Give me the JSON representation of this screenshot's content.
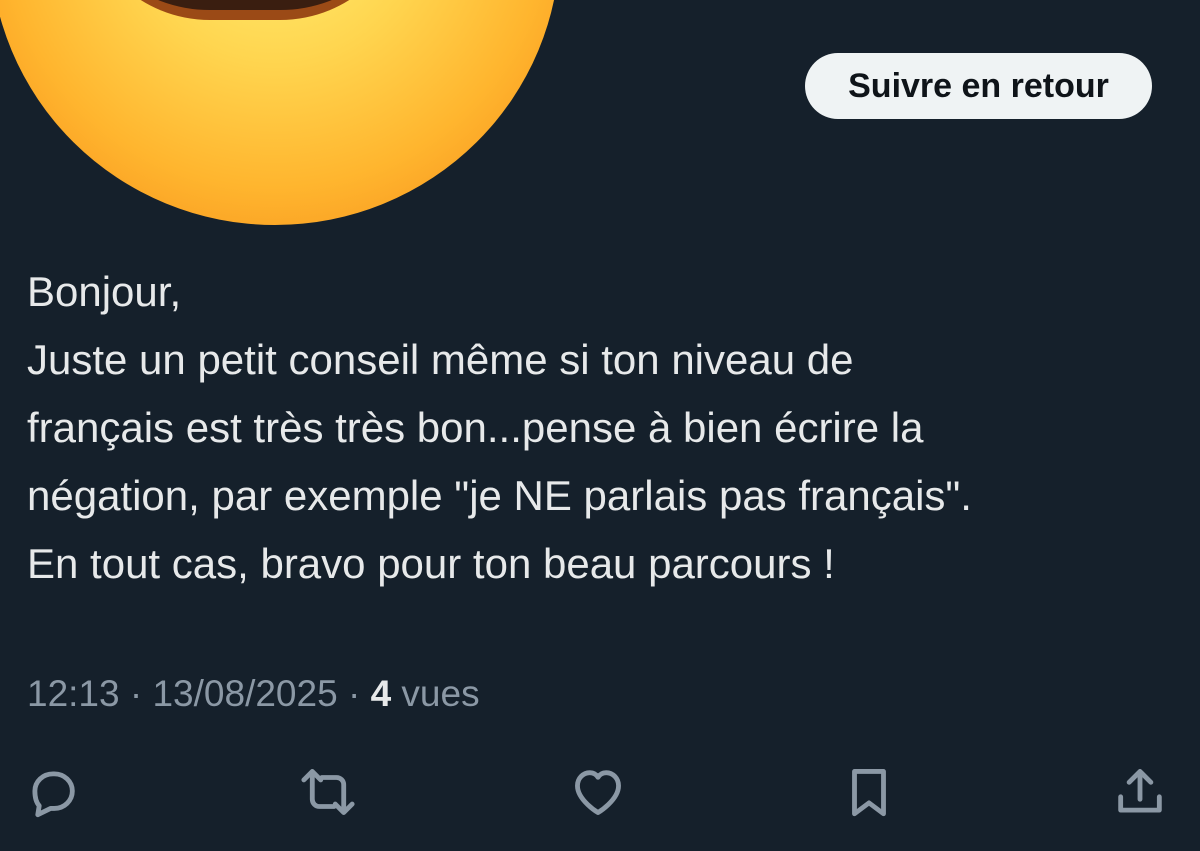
{
  "header": {
    "follow_button_label": "Suivre en retour"
  },
  "tweet": {
    "lines": [
      "Bonjour,",
      "Juste un petit conseil même si ton niveau de",
      "français est très très bon...pense à bien écrire la",
      "négation, par exemple \"je NE parlais pas français\".",
      "En tout cas, bravo pour ton beau parcours !"
    ],
    "time": "12:13",
    "separator": "·",
    "date": "13/08/2025",
    "views_count": "4",
    "views_label": "vues"
  },
  "actions": {
    "icons": [
      "reply-icon",
      "retweet-icon",
      "like-icon",
      "bookmark-icon",
      "share-icon"
    ]
  },
  "colors": {
    "background": "#15202b",
    "text_primary": "#e7e9ea",
    "text_secondary": "#8b98a5",
    "button_bg": "#eff3f4",
    "button_text": "#0f1419"
  }
}
